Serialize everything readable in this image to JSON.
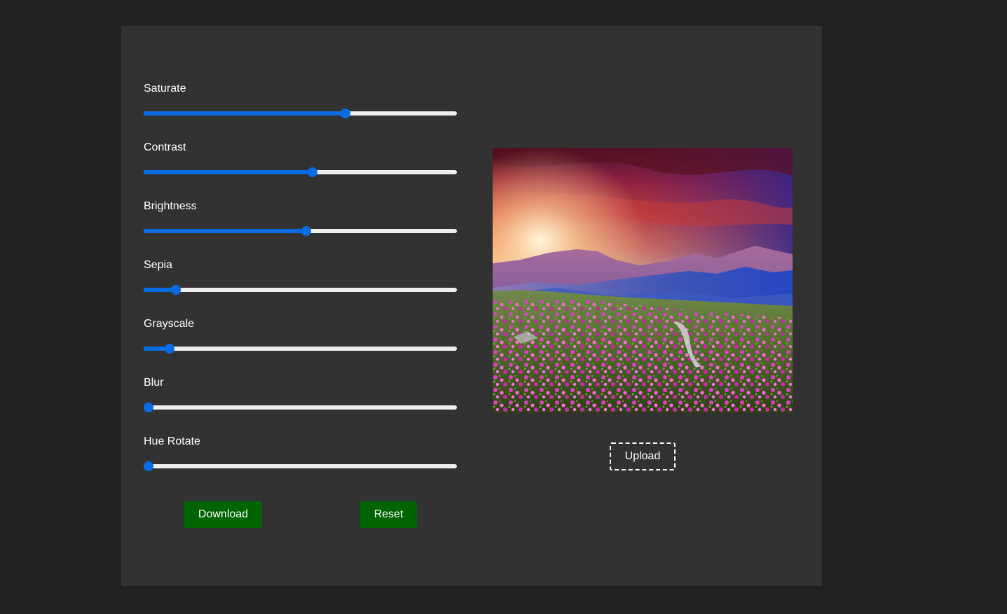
{
  "filters": [
    {
      "id": "saturate",
      "label": "Saturate",
      "value": 0.65
    },
    {
      "id": "contrast",
      "label": "Contrast",
      "value": 0.54
    },
    {
      "id": "brightness",
      "label": "Brightness",
      "value": 0.52
    },
    {
      "id": "sepia",
      "label": "Sepia",
      "value": 0.09
    },
    {
      "id": "grayscale",
      "label": "Grayscale",
      "value": 0.07
    },
    {
      "id": "blur",
      "label": "Blur",
      "value": 0.0
    },
    {
      "id": "hue-rotate",
      "label": "Hue Rotate",
      "value": 0.0
    }
  ],
  "actions": {
    "download_label": "Download",
    "reset_label": "Reset",
    "upload_label": "Upload"
  },
  "theme": {
    "accent": "#0a6ce3",
    "button_green": "#006400",
    "panel_bg": "#323232",
    "page_bg": "#222222"
  },
  "image": {
    "description_icon": "landscape-photo",
    "alt": ""
  }
}
